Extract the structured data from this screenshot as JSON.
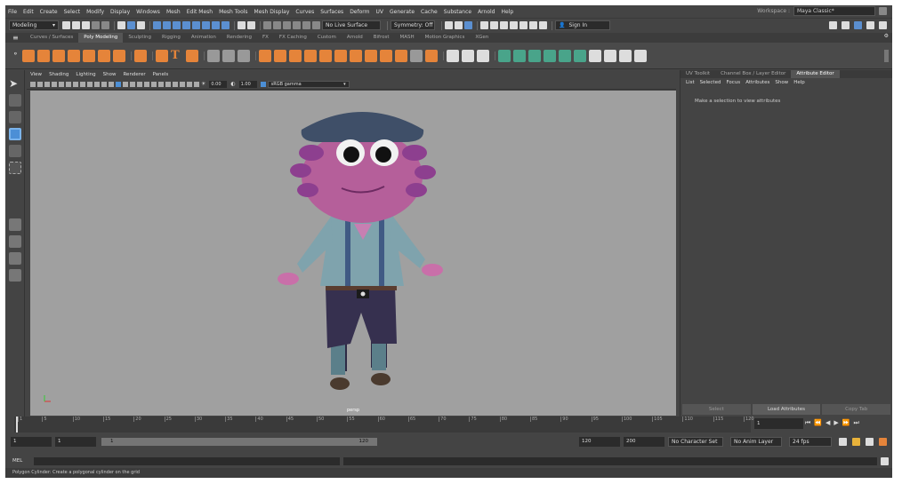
{
  "menubar": {
    "items": [
      "File",
      "Edit",
      "Create",
      "Select",
      "Modify",
      "Display",
      "Windows",
      "Mesh",
      "Edit Mesh",
      "Mesh Tools",
      "Mesh Display",
      "Curves",
      "Surfaces",
      "Deform",
      "UV",
      "Generate",
      "Cache",
      "Substance",
      "Arnold",
      "Help"
    ],
    "workspace_label": "Workspace :",
    "workspace_value": "Maya Classic*"
  },
  "statusline": {
    "mode": "Modeling",
    "live_surface": "No Live Surface",
    "symmetry": "Symmetry: Off",
    "sign_in": "Sign In"
  },
  "shelf": {
    "tabs": [
      "Curves / Surfaces",
      "Poly Modeling",
      "Sculpting",
      "Rigging",
      "Animation",
      "Rendering",
      "FX",
      "FX Caching",
      "Custom",
      "Arnold",
      "Bifrost",
      "MASH",
      "Motion Graphics",
      "XGen"
    ],
    "active_tab": "Poly Modeling"
  },
  "viewport": {
    "menus": [
      "View",
      "Shading",
      "Lighting",
      "Show",
      "Renderer",
      "Panels"
    ],
    "exposure": "0.00",
    "gamma": "1.00",
    "color_space": "sRGB gamma",
    "camera": "persp"
  },
  "side_panel": {
    "tabs": [
      "UV Toolkit",
      "Channel Box / Layer Editor",
      "Attribute Editor"
    ],
    "active_tab": "Attribute Editor",
    "menus": [
      "List",
      "Selected",
      "Focus",
      "Attributes",
      "Show",
      "Help"
    ],
    "message": "Make a selection to view attributes",
    "buttons": [
      "Select",
      "Load Attributes",
      "Copy Tab"
    ]
  },
  "timeline": {
    "ticks": [
      "1",
      "5",
      "10",
      "15",
      "20",
      "25",
      "30",
      "35",
      "40",
      "45",
      "50",
      "55",
      "60",
      "65",
      "70",
      "75",
      "80",
      "85",
      "90",
      "95",
      "100",
      "105",
      "110",
      "115",
      "120"
    ],
    "current_frame": "1"
  },
  "range": {
    "start": "1",
    "playback_start": "1",
    "slider_start": "1",
    "slider_end": "120",
    "playback_end": "120",
    "end": "200",
    "character_set": "No Character Set",
    "anim_layer": "No Anim Layer",
    "fps": "24 fps"
  },
  "command": {
    "label": "MEL"
  },
  "help_line": "Polygon Cylinder: Create a polygonal cylinder on the grid"
}
